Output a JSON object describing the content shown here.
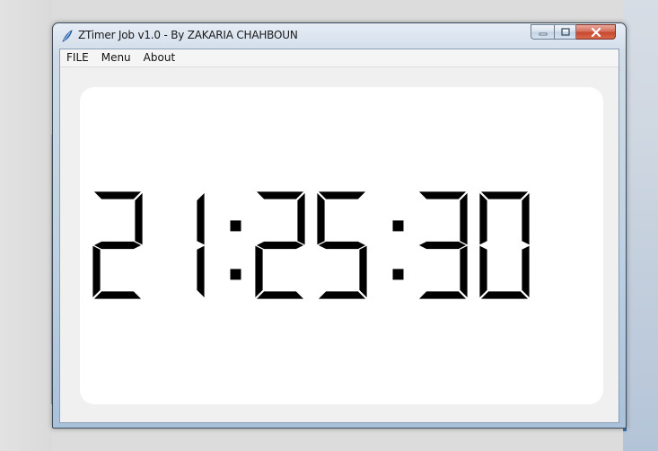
{
  "window": {
    "title": "ZTimer Job v1.0 - By ZAKARIA CHAHBOUN",
    "icon": "feather-app-icon",
    "caption_buttons": [
      "minimize",
      "maximize",
      "close"
    ]
  },
  "menu": {
    "items": [
      {
        "label": "FILE"
      },
      {
        "label": "Menu"
      },
      {
        "label": "About"
      }
    ]
  },
  "clock": {
    "time": "21:25:30",
    "hours": "21",
    "minutes": "25",
    "seconds": "30",
    "style": "seven-segment",
    "color": "#000000"
  },
  "colors": {
    "panel_background": "#ffffff",
    "client_background": "#f0f0f0",
    "close_button": "#c7472f"
  }
}
